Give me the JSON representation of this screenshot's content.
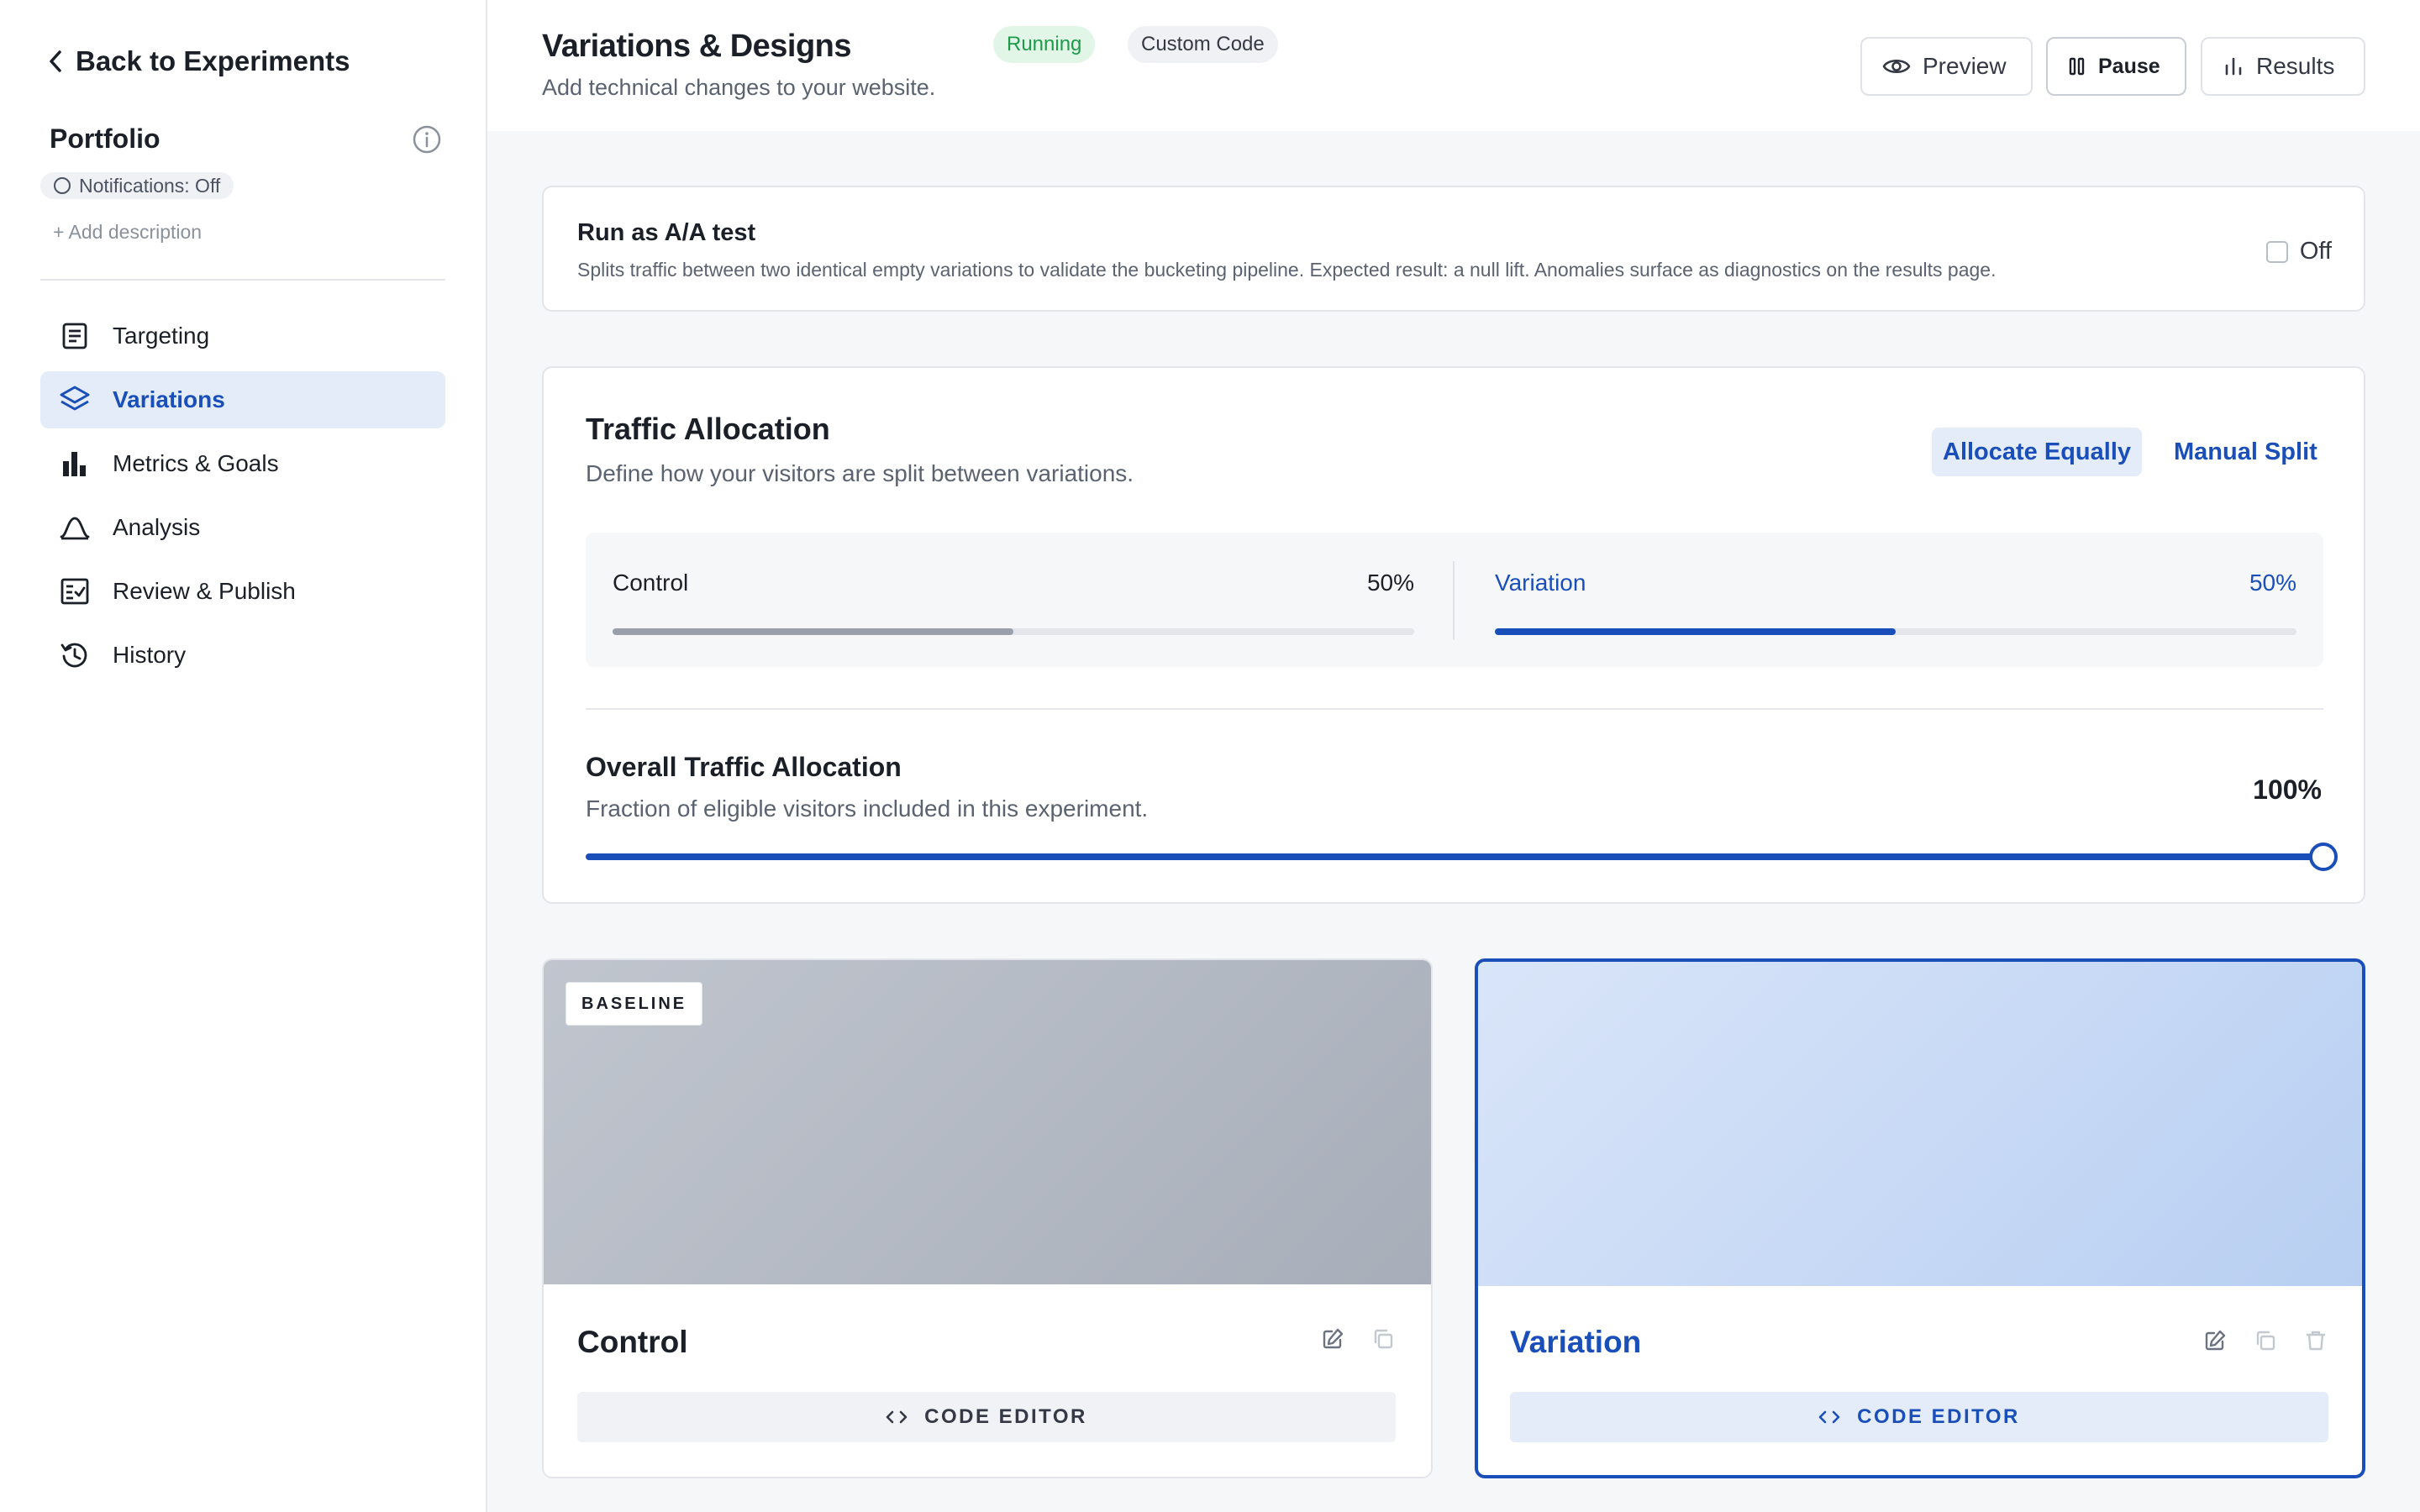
{
  "sidebar": {
    "back_label": "Back to Experiments",
    "project_title": "Portfolio",
    "notifications": "Notifications: Off",
    "add_description": "+ Add description",
    "items": [
      {
        "label": "Targeting",
        "icon": "document-list-icon",
        "active": false
      },
      {
        "label": "Variations",
        "icon": "layers-icon",
        "active": true
      },
      {
        "label": "Metrics & Goals",
        "icon": "bar-chart-icon",
        "active": false
      },
      {
        "label": "Analysis",
        "icon": "bell-curve-icon",
        "active": false
      },
      {
        "label": "Review & Publish",
        "icon": "checklist-icon",
        "active": false
      },
      {
        "label": "History",
        "icon": "history-icon",
        "active": false
      }
    ]
  },
  "header": {
    "title": "Variations & Designs",
    "subtitle": "Add technical changes to your website.",
    "status_badge": "Running",
    "type_badge": "Custom Code",
    "preview_label": "Preview",
    "pause_label": "Pause",
    "results_label": "Results"
  },
  "aa_test": {
    "title": "Run as A/A test",
    "description": "Splits traffic between two identical empty variations to validate the bucketing pipeline. Expected result: a null lift. Anomalies surface as diagnostics on the results page.",
    "toggle_label": "Off",
    "enabled": false
  },
  "traffic": {
    "title": "Traffic Allocation",
    "subtitle": "Define how your visitors are split between variations.",
    "allocate_equally_label": "Allocate Equally",
    "manual_split_label": "Manual Split",
    "splits": [
      {
        "name": "Control",
        "percent_label": "50%",
        "fraction": 0.5,
        "color": "#9aa0ab"
      },
      {
        "name": "Variation",
        "percent_label": "50%",
        "fraction": 0.5,
        "color": "#1a4fba"
      }
    ],
    "overall_title": "Overall Traffic Allocation",
    "overall_subtitle": "Fraction of eligible visitors included in this experiment.",
    "overall_percent_label": "100%",
    "overall_fraction": 1.0
  },
  "variations": [
    {
      "name": "Control",
      "tag": "BASELINE",
      "code_editor_label": "CODE EDITOR"
    },
    {
      "name": "Variation",
      "code_editor_label": "CODE EDITOR"
    }
  ],
  "colors": {
    "accent": "#1a4fba",
    "running_bg": "#e2f6e8",
    "running_text": "#1e9a4a"
  }
}
